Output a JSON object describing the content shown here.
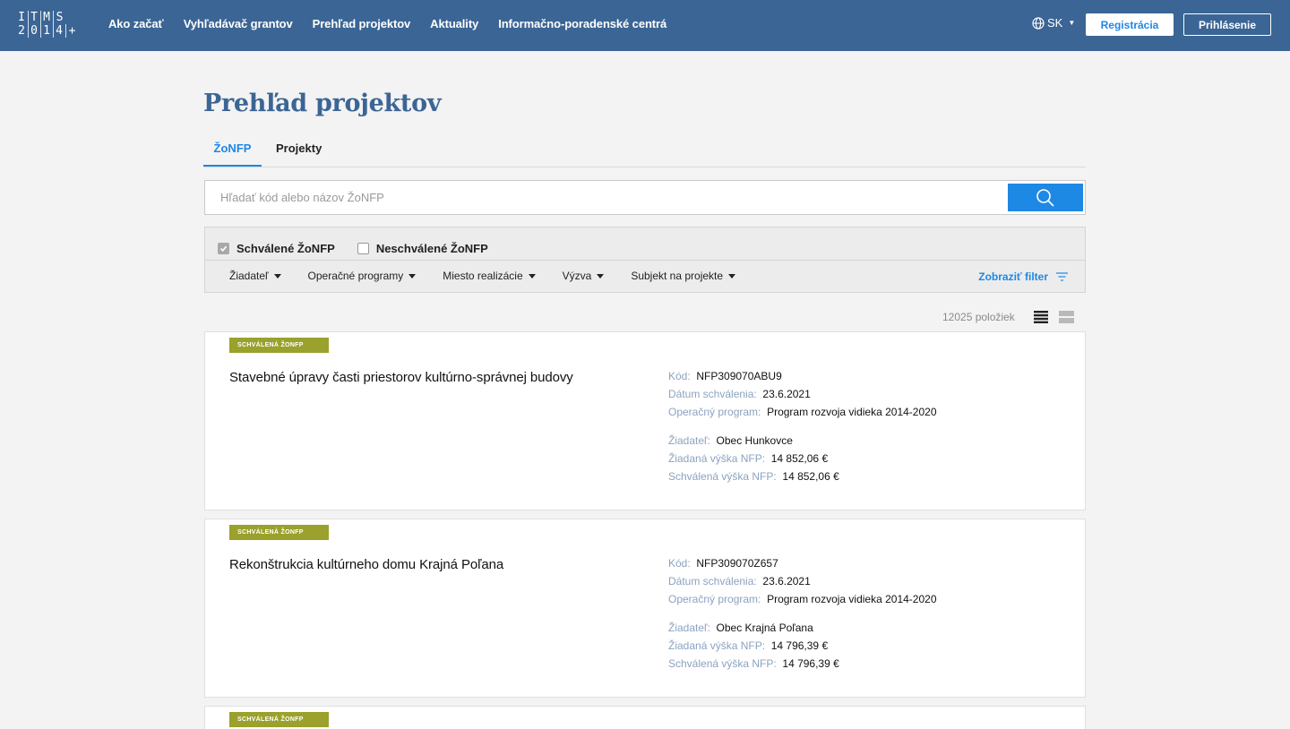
{
  "header": {
    "logo_top": [
      "I",
      "T",
      "M",
      "S"
    ],
    "logo_bottom": [
      "2",
      "0",
      "1",
      "4",
      "+"
    ],
    "nav": [
      "Ako začať",
      "Vyhľadávač grantov",
      "Prehľad projektov",
      "Aktuality",
      "Informačno-poradenské centrá"
    ],
    "language": "SK",
    "register_label": "Registrácia",
    "login_label": "Prihlásenie"
  },
  "page": {
    "title": "Prehľad projektov",
    "tabs": [
      "ŽoNFP",
      "Projekty"
    ],
    "search_placeholder": "Hľadať kód alebo názov ŽoNFP"
  },
  "filters": {
    "approved_label": "Schválené ŽoNFP",
    "approved_checked": true,
    "unapproved_label": "Neschválené ŽoNFP",
    "unapproved_checked": false,
    "dropdowns": [
      "Žiadateľ",
      "Operačné programy",
      "Miesto realizácie",
      "Výzva",
      "Subjekt na projekte"
    ],
    "show_filter_label": "Zobraziť filter"
  },
  "results": {
    "count": "12025 položiek",
    "items": [
      {
        "badge": "SCHVÁLENÁ ŽONFP",
        "title": "Stavebné úpravy časti priestorov kultúrno-správnej budovy",
        "code_label": "Kód:",
        "code": "NFP309070ABU9",
        "date_label": "Dátum schválenia:",
        "date": "23.6.2021",
        "program_label": "Operačný program:",
        "program": "Program rozvoja vidieka 2014-2020",
        "applicant_label": "Žiadateľ:",
        "applicant": "Obec Hunkovce",
        "requested_label": "Žiadaná výška NFP:",
        "requested": "14 852,06 €",
        "approved_label": "Schválená výška NFP:",
        "approved": "14 852,06 €"
      },
      {
        "badge": "SCHVÁLENÁ ŽONFP",
        "title": "Rekonštrukcia kultúrneho domu Krajná Poľana",
        "code_label": "Kód:",
        "code": "NFP309070Z657",
        "date_label": "Dátum schválenia:",
        "date": "23.6.2021",
        "program_label": "Operačný program:",
        "program": "Program rozvoja vidieka 2014-2020",
        "applicant_label": "Žiadateľ:",
        "applicant": "Obec Krajná Poľana",
        "requested_label": "Žiadaná výška NFP:",
        "requested": "14 796,39 €",
        "approved_label": "Schválená výška NFP:",
        "approved": "14 796,39 €"
      },
      {
        "badge": "SCHVÁLENÁ ŽONFP"
      }
    ]
  },
  "colors": {
    "header_bg": "#3b6595",
    "accent": "#1e88e5",
    "badge": "#9aa12c",
    "meta_label": "#8ba3bf"
  }
}
